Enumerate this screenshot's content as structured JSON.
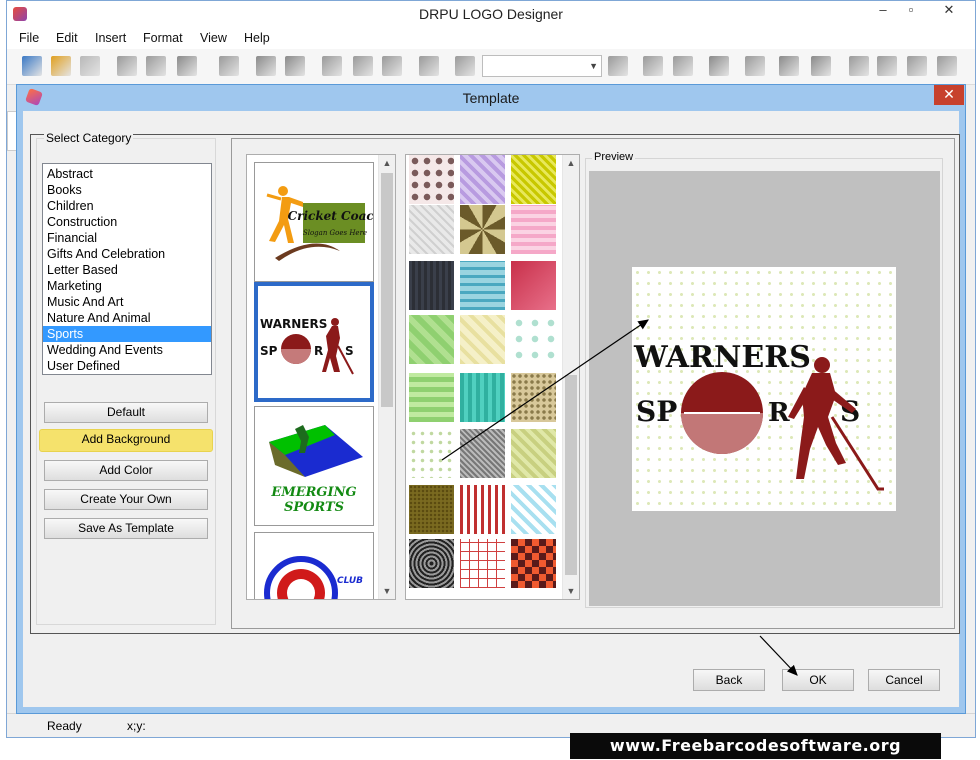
{
  "app": {
    "title": "DRPU LOGO Designer",
    "menu": [
      "File",
      "Edit",
      "Insert",
      "Format",
      "View",
      "Help"
    ],
    "window_buttons": {
      "minimize": "–",
      "maximize": "▫",
      "close": "✕"
    },
    "toolbar_icons": [
      "new-icon",
      "open-icon",
      "close-doc-icon",
      "save-icon",
      "save-as-icon",
      "import-icon",
      "print-icon",
      "undo-icon",
      "redo-icon",
      "cut-icon",
      "copy-icon",
      "paste-icon",
      "delete-icon",
      "zoom-in-icon",
      "zoom-combo",
      "zoom-out-icon",
      "actual-size-icon",
      "fit-icon",
      "grid-icon",
      "edit-icon",
      "bring-front-icon",
      "send-back-icon",
      "align-left-icon",
      "align-right-icon",
      "center-icon",
      "align-top-icon"
    ]
  },
  "status": {
    "ready": "Ready",
    "coords": "x;y:"
  },
  "dialog": {
    "title": "Template",
    "close_label": "✕",
    "select_category_label": "Select Category",
    "categories": [
      "Abstract",
      "Books",
      "Children",
      "Construction",
      "Financial",
      "Gifts And Celebration",
      "Letter Based",
      "Marketing",
      "Music And Art",
      "Nature And Animal",
      "Sports",
      "Wedding And Events",
      "User Defined"
    ],
    "selected_category": "Sports",
    "side_buttons": {
      "default": "Default",
      "add_background": "Add Background",
      "add_color": "Add Color",
      "create_your_own": "Create Your Own",
      "save_as_template": "Save As Template"
    },
    "templates": [
      {
        "name": "cricket-coach",
        "line1": "Cricket Coach",
        "line2": "Slogan Goes Here"
      },
      {
        "name": "warners-sports",
        "line1": "WARNERS",
        "line2a": "SP",
        "line2b": "R",
        "line2c": "S"
      },
      {
        "name": "emerging-sports",
        "line1": "EMERGING",
        "line2": "SPORTS"
      },
      {
        "name": "club",
        "line1": "CLUB"
      }
    ],
    "preview_label": "Preview",
    "preview_logo": {
      "line1": "WARNERS",
      "sp": "SP",
      "r": "R",
      "s": "S"
    },
    "buttons": {
      "back": "Back",
      "ok": "OK",
      "cancel": "Cancel"
    }
  },
  "watermark": "www.Freebarcodesoftware.org",
  "colors": {
    "selection": "#3399ff",
    "highlight": "#f5e26c",
    "logo_red": "#8b1a1a",
    "dialog_frame": "#9fc7ee"
  }
}
